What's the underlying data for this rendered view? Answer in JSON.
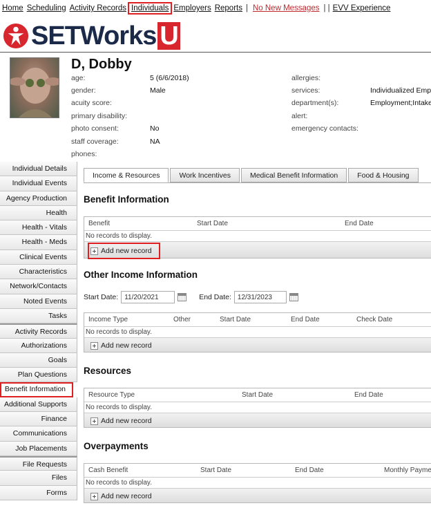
{
  "nav": {
    "items": [
      "Home",
      "Scheduling",
      "Activity Records",
      "Individuals",
      "Employers",
      "Reports"
    ],
    "messages": "No New Messages",
    "separator": "| |",
    "evv": "EVV Experience"
  },
  "logo": {
    "text": "SETWorks",
    "u": "U"
  },
  "person": {
    "name": "D, Dobby",
    "fields": [
      {
        "label": "age:",
        "value": "5 (6/6/2018)"
      },
      {
        "label": "gender:",
        "value": "Male"
      },
      {
        "label": "acuity score:",
        "value": ""
      },
      {
        "label": "primary disability:",
        "value": ""
      },
      {
        "label": "photo consent:",
        "value": "No"
      },
      {
        "label": "staff coverage:",
        "value": "NA"
      },
      {
        "label": "phones:",
        "value": ""
      }
    ],
    "right_fields": [
      {
        "label": "allergies:",
        "value": ""
      },
      {
        "label": "services:",
        "value": "Individualized Emp"
      },
      {
        "label": "department(s):",
        "value": "Employment;Intake"
      },
      {
        "label": "alert:",
        "value": ""
      },
      {
        "label": "emergency contacts:",
        "value": ""
      }
    ]
  },
  "sidebar": {
    "items": [
      "Individual Details",
      "Individual Events",
      "Agency Production",
      "Health",
      "Health - Vitals",
      "Health - Meds",
      "Clinical Events",
      "Characteristics",
      "Network/Contacts",
      "Noted Events",
      "Tasks",
      "Activity Records",
      "Authorizations",
      "Goals",
      "Plan Questions",
      "Benefit Information",
      "Additional Supports",
      "Finance",
      "Communications",
      "Job Placements",
      "File Requests",
      "Files",
      "Forms"
    ]
  },
  "tabs": [
    "Income & Resources",
    "Work Incentives",
    "Medical Benefit Information",
    "Food & Housing"
  ],
  "sections": {
    "benefit": {
      "title": "Benefit Information",
      "headers": [
        "Benefit",
        "Start Date",
        "End Date"
      ],
      "empty": "No records to display.",
      "add": "Add new record"
    },
    "income": {
      "title": "Other Income Information",
      "start_label": "Start Date:",
      "start_value": "11/20/2021",
      "end_label": "End Date:",
      "end_value": "12/31/2023",
      "headers": [
        "Income Type",
        "Other",
        "Start Date",
        "End Date",
        "Check Date"
      ],
      "empty": "No records to display.",
      "add": "Add new record"
    },
    "resources": {
      "title": "Resources",
      "headers": [
        "Resource Type",
        "Start Date",
        "End Date"
      ],
      "empty": "No records to display.",
      "add": "Add new record"
    },
    "overpayments": {
      "title": "Overpayments",
      "headers": [
        "Cash Benefit",
        "Start Date",
        "End Date",
        "Monthly Payme"
      ],
      "empty": "No records to display.",
      "add": "Add new record"
    }
  },
  "colors": {
    "highlight": "#e02020",
    "brand_navy": "#1c2a4a",
    "brand_red": "#d7262e"
  }
}
